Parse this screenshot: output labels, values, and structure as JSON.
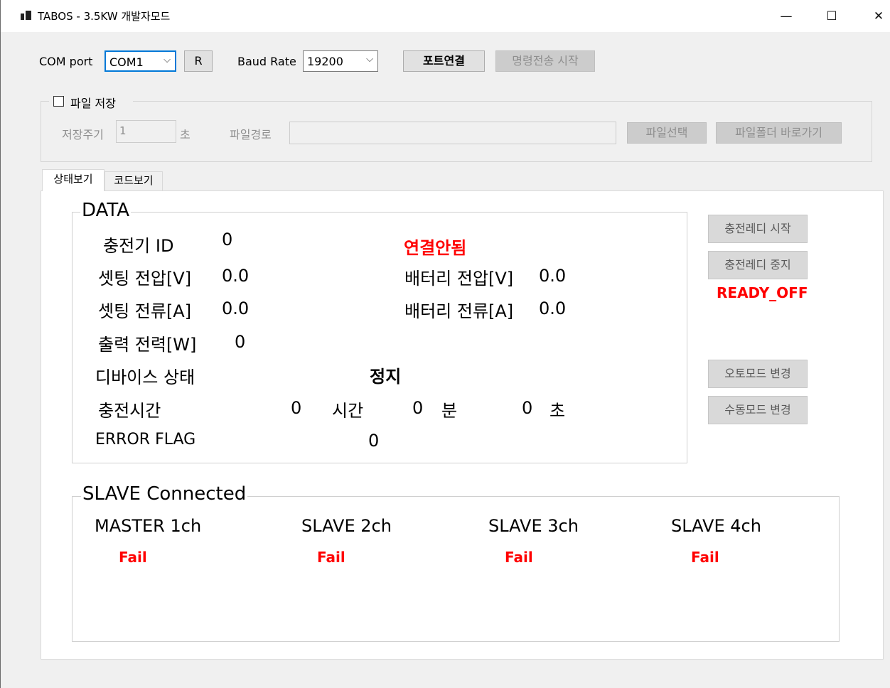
{
  "window": {
    "title": "TABOS - 3.5KW 개발자모드",
    "minimize": "—",
    "maximize": "☐",
    "close": "✕"
  },
  "toolbar": {
    "com_port_label": "COM port",
    "com_port_value": "COM1",
    "refresh_label": "R",
    "baud_rate_label": "Baud Rate",
    "baud_rate_value": "19200",
    "connect_label": "포트연결",
    "send_label": "명령전송 시작"
  },
  "file_save": {
    "checkbox_label": "파일 저장",
    "checked": false,
    "interval_label": "저장주기",
    "interval_value": "1",
    "interval_unit": "초",
    "path_label": "파일경로",
    "path_value": "",
    "select_label": "파일선택",
    "open_folder_label": "파일폴더 바로가기"
  },
  "tabs": [
    {
      "label": "상태보기",
      "active": true
    },
    {
      "label": "코드보기",
      "active": false
    }
  ],
  "data_group": {
    "title": "DATA",
    "charger_id_label": "충전기 ID",
    "charger_id_value": "0",
    "connection_status": "연결안됨",
    "set_voltage_label": "셋팅 전압[V]",
    "set_voltage_value": "0.0",
    "battery_voltage_label": "배터리 전압[V]",
    "battery_voltage_value": "0.0",
    "set_current_label": "셋팅 전류[A]",
    "set_current_value": "0.0",
    "battery_current_label": "배터리 전류[A]",
    "battery_current_value": "0.0",
    "output_power_label": "출력 전력[W]",
    "output_power_value": "0",
    "device_status_label": "디바이스 상태",
    "device_status_value": "정지",
    "charge_time_label": "충전시간",
    "hours_value": "0",
    "hours_unit": "시간",
    "minutes_value": "0",
    "minutes_unit": "분",
    "seconds_value": "0",
    "seconds_unit": "초",
    "error_flag_label": "ERROR FLAG",
    "error_flag_value": "0"
  },
  "side": {
    "ready_start_label": "충전레디 시작",
    "ready_stop_label": "충전레디 중지",
    "ready_status": "READY_OFF",
    "auto_mode_label": "오토모드 변경",
    "manual_mode_label": "수동모드 변경"
  },
  "slave_group": {
    "title": "SLAVE Connected",
    "channels": [
      {
        "name": "MASTER 1ch",
        "status": "Fail"
      },
      {
        "name": "SLAVE 2ch",
        "status": "Fail"
      },
      {
        "name": "SLAVE 3ch",
        "status": "Fail"
      },
      {
        "name": "SLAVE 4ch",
        "status": "Fail"
      }
    ]
  },
  "colors": {
    "error_red": "#ff0000",
    "focus_blue": "#0078d7"
  }
}
